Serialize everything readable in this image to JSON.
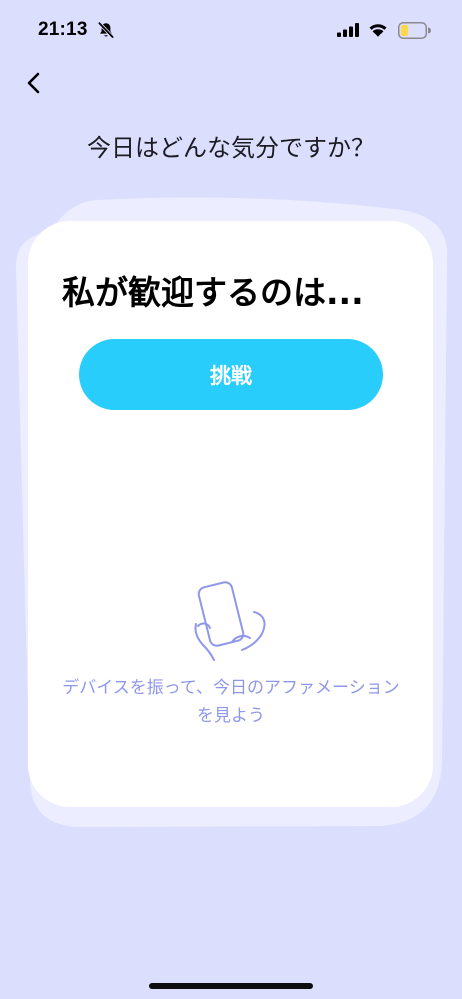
{
  "status_bar": {
    "time": "21:13"
  },
  "header": {
    "title": "今日はどんな気分ですか？"
  },
  "card": {
    "heading": "私が歓迎するのは...",
    "choice_button_label": "挑戦",
    "hint_line1": "デバイスを振って、今日のアファメーション",
    "hint_line2": "を見よう"
  },
  "colors": {
    "background": "#dcdefe",
    "card_back": "#eceeff",
    "card_front": "#ffffff",
    "accent_button": "#29cdfb",
    "hint_text": "#8f97ea",
    "battery_fill": "#ffd84a"
  },
  "icons": {
    "back": "chevron-left-icon",
    "bell": "bell-slash-icon",
    "signal": "cellular-signal-icon",
    "wifi": "wifi-icon",
    "battery": "battery-icon",
    "shake": "hand-holding-phone-icon"
  }
}
